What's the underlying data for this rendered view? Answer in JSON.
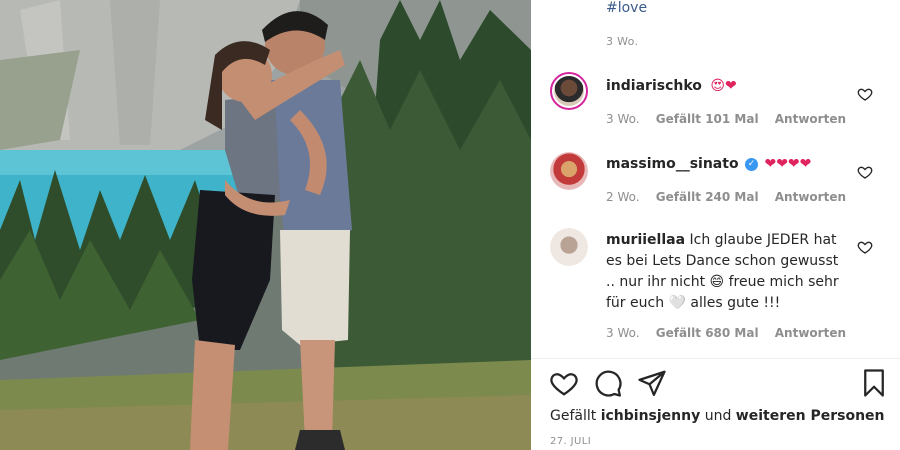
{
  "post": {
    "caption_hashtag": "#love",
    "caption_time": "3 Wo.",
    "likes_prefix": "Gefällt",
    "likes_user": "ichbinsjenny",
    "likes_and": "und",
    "likes_suffix": "weiteren Personen",
    "date": "27. JULI"
  },
  "comments": [
    {
      "username": "indiarischko",
      "text": "😍❤",
      "time": "3 Wo.",
      "likes": "Gefällt 101 Mal",
      "reply": "Antworten",
      "verified": false
    },
    {
      "username": "massimo__sinato",
      "verified_mark": "✓",
      "text": "❤❤❤❤",
      "time": "2 Wo.",
      "likes": "Gefällt 240 Mal",
      "reply": "Antworten",
      "verified": true
    },
    {
      "username": "muriiellaa",
      "text": "Ich glaube JEDER hat es bei Lets Dance schon gewusst .. nur ihr nicht 😄 freue mich sehr für euch 🤍 alles gute !!!",
      "time": "3 Wo.",
      "likes": "Gefällt 680 Mal",
      "reply": "Antworten",
      "verified": false
    }
  ],
  "icons": {
    "like": "heart-icon",
    "comment": "comment-icon",
    "share": "share-icon",
    "save": "bookmark-icon",
    "comment_like": "heart-outline-icon"
  },
  "colors": {
    "hashtag": "#3b5b8a",
    "muted": "#8e8e8e",
    "text": "#262626",
    "verified": "#3897f0",
    "heart_emoji": "#e0245e"
  }
}
